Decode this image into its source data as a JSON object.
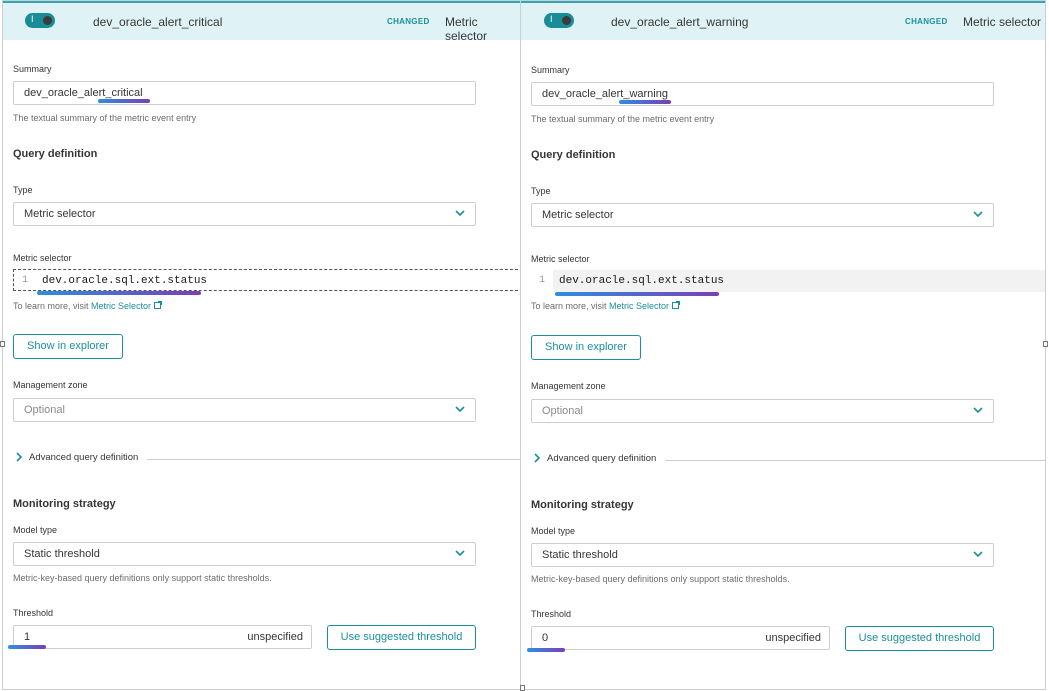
{
  "panels": [
    {
      "id": "left",
      "header": {
        "toggle_text": "I",
        "name": "dev_oracle_alert_critical",
        "badge": "CHANGED",
        "type": "Metric selector"
      },
      "summary": {
        "label": "Summary",
        "value": "dev_oracle_alert_critical",
        "help": "The textual summary of the metric event entry"
      },
      "query_definition": {
        "title": "Query definition"
      },
      "type_field": {
        "label": "Type",
        "value": "Metric selector"
      },
      "metric_selector": {
        "label": "Metric selector",
        "line_number": "1",
        "code": "dev.oracle.sql.ext.status",
        "learn_prefix": "To learn more, visit ",
        "learn_link": "Metric Selector"
      },
      "show_in_explorer": "Show in explorer",
      "management_zone": {
        "label": "Management zone",
        "placeholder": "Optional"
      },
      "advanced": "Advanced query definition",
      "monitoring": {
        "title": "Monitoring strategy"
      },
      "model_type": {
        "label": "Model type",
        "value": "Static threshold",
        "help": "Metric-key-based query definitions only support static thresholds."
      },
      "threshold": {
        "label": "Threshold",
        "value": "1",
        "unit": "unspecified",
        "suggest_button": "Use suggested threshold"
      }
    },
    {
      "id": "right",
      "header": {
        "toggle_text": "I",
        "name": "dev_oracle_alert_warning",
        "badge": "CHANGED",
        "type": "Metric selector"
      },
      "summary": {
        "label": "Summary",
        "value": "dev_oracle_alert_warning",
        "help": "The textual summary of the metric event entry"
      },
      "query_definition": {
        "title": "Query definition"
      },
      "type_field": {
        "label": "Type",
        "value": "Metric selector"
      },
      "metric_selector": {
        "label": "Metric selector",
        "line_number": "1",
        "code": "dev.oracle.sql.ext.status",
        "learn_prefix": "To learn more, visit ",
        "learn_link": "Metric Selector"
      },
      "show_in_explorer": "Show in explorer",
      "management_zone": {
        "label": "Management zone",
        "placeholder": "Optional"
      },
      "advanced": "Advanced query definition",
      "monitoring": {
        "title": "Monitoring strategy"
      },
      "model_type": {
        "label": "Model type",
        "value": "Static threshold",
        "help": "Metric-key-based query definitions only support static thresholds."
      },
      "threshold": {
        "label": "Threshold",
        "value": "0",
        "unit": "unspecified",
        "suggest_button": "Use suggested threshold"
      }
    }
  ],
  "colors": {
    "accent": "#1b8f9c",
    "header_bg": "#dff3f6",
    "toggle": "#1a8c98",
    "highlight_start": "#2d8fe0",
    "highlight_end": "#7a3fb8"
  },
  "icons": {
    "toggle": "toggle-switch-icon",
    "dropdown": "chevron-down-icon",
    "external": "external-link-icon",
    "expand": "chevron-right-icon"
  }
}
